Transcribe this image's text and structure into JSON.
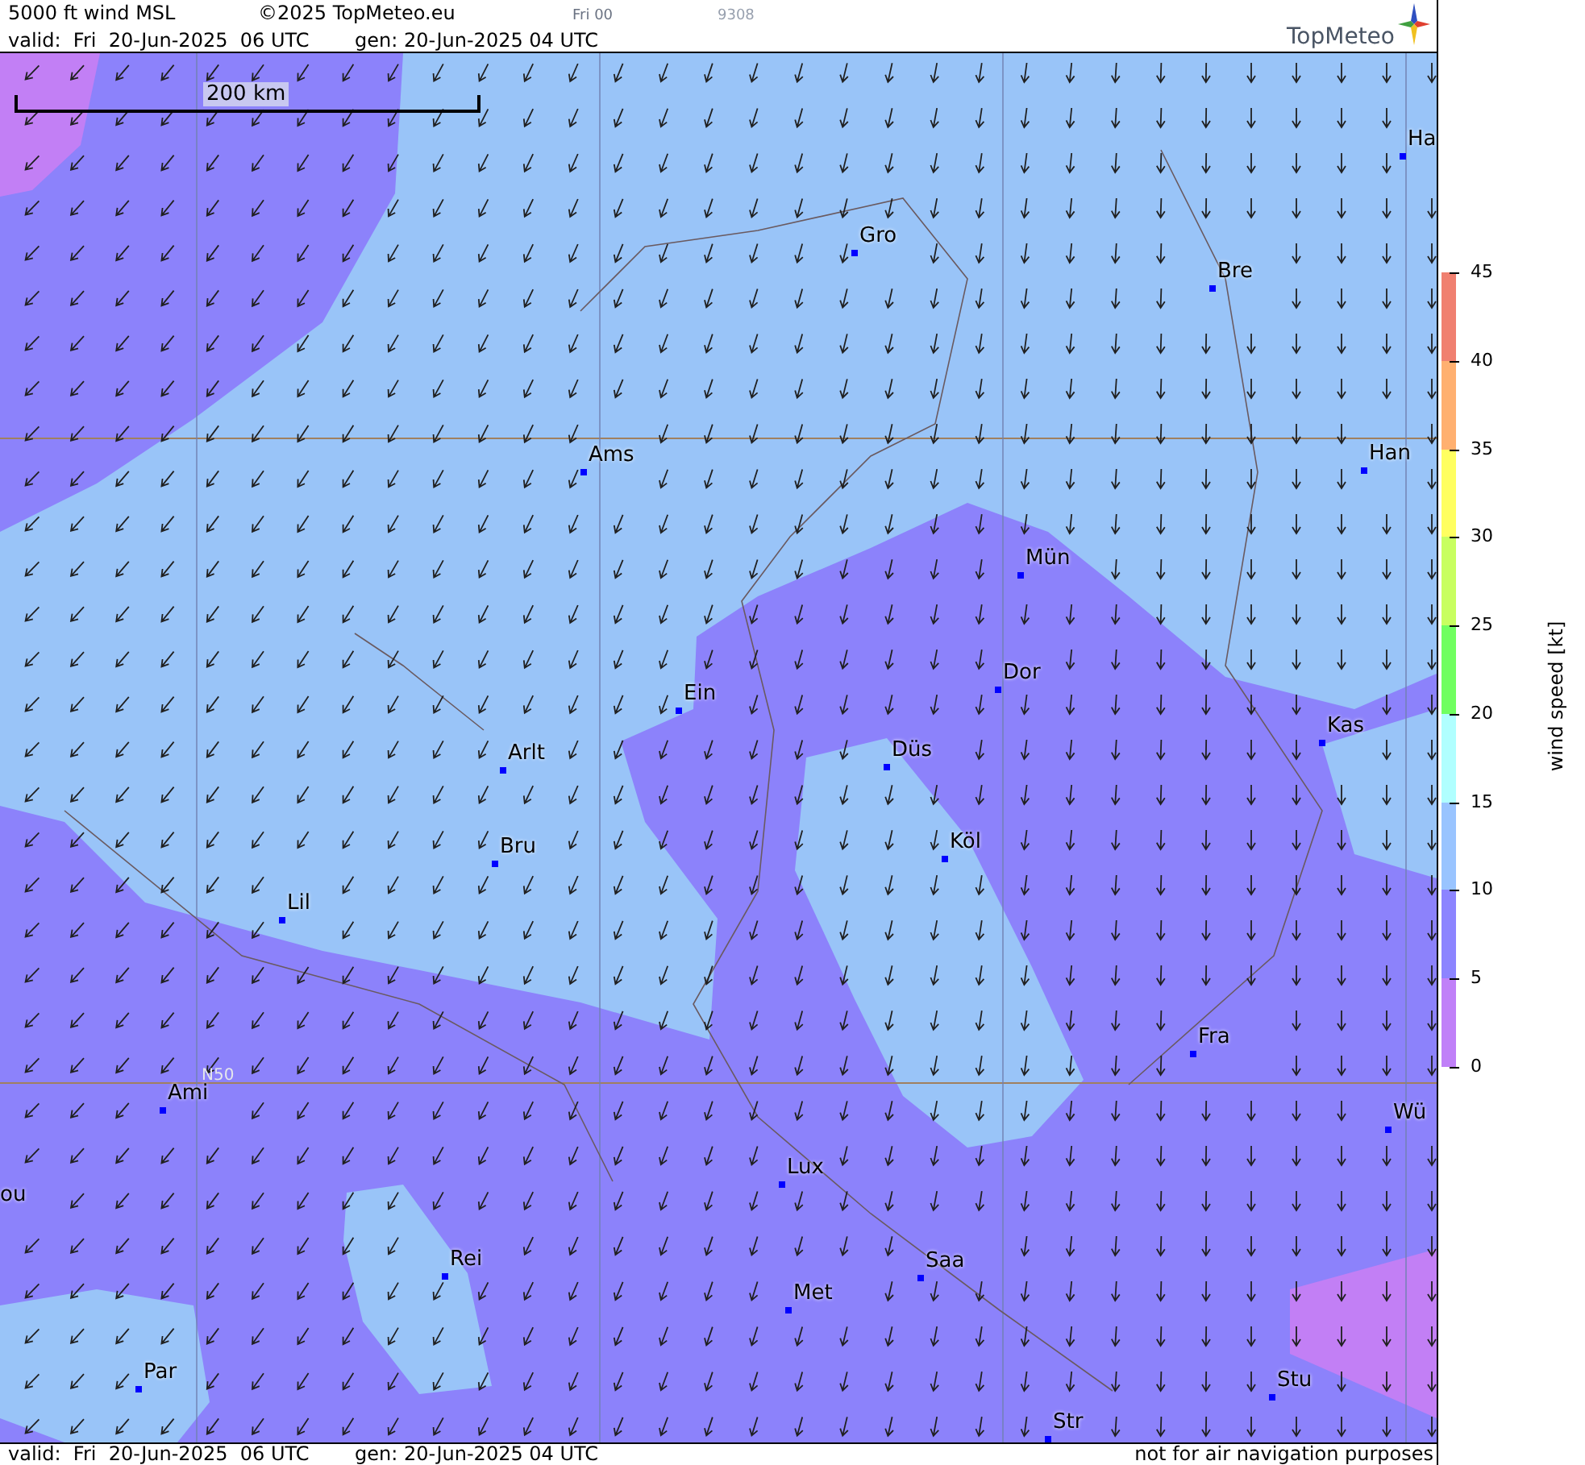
{
  "header": {
    "title": "5000 ft wind MSL",
    "copyright": "©2025 TopMeteo.eu",
    "run": "Fri 00",
    "code": "9308",
    "valid": "valid:  Fri  20-Jun-2025  06 UTC",
    "generated": "gen: 20-Jun-2025 04 UTC",
    "logo": "TopMeteo"
  },
  "map": {
    "scale_label": "200 km",
    "grid_label": "N50",
    "cities": [
      {
        "name": "Ha"
      },
      {
        "name": "Gro"
      },
      {
        "name": "Bre"
      },
      {
        "name": "Ams"
      },
      {
        "name": "Han"
      },
      {
        "name": "Mün"
      },
      {
        "name": "Dor"
      },
      {
        "name": "Ein"
      },
      {
        "name": "Kas"
      },
      {
        "name": "Düs"
      },
      {
        "name": "Arlt"
      },
      {
        "name": "Köl"
      },
      {
        "name": "Bru"
      },
      {
        "name": "Lil"
      },
      {
        "name": "Fra"
      },
      {
        "name": "Ami"
      },
      {
        "name": "Wü"
      },
      {
        "name": "Lux"
      },
      {
        "name": "ou"
      },
      {
        "name": "Rei"
      },
      {
        "name": "Saa"
      },
      {
        "name": "Met"
      },
      {
        "name": "Stu"
      },
      {
        "name": "Par"
      },
      {
        "name": "Str"
      }
    ]
  },
  "legend": {
    "title": "wind speed [kt]",
    "ticks": [
      "45",
      "40",
      "35",
      "30",
      "25",
      "20",
      "15",
      "10",
      "5",
      "0"
    ],
    "segments": [
      {
        "color": "#f08070"
      },
      {
        "color": "#ffb070"
      },
      {
        "color": "#ffff60"
      },
      {
        "color": "#c8ff60"
      },
      {
        "color": "#70ff60"
      },
      {
        "color": "#b0ffff"
      },
      {
        "color": "#99c4ff"
      },
      {
        "color": "#8c84ff"
      },
      {
        "color": "#c080f8"
      }
    ]
  },
  "footer": {
    "valid": "valid:  Fri  20-Jun-2025  06 UTC",
    "generated": "gen: 20-Jun-2025 04 UTC",
    "disclaimer": "not for air navigation purposes"
  }
}
